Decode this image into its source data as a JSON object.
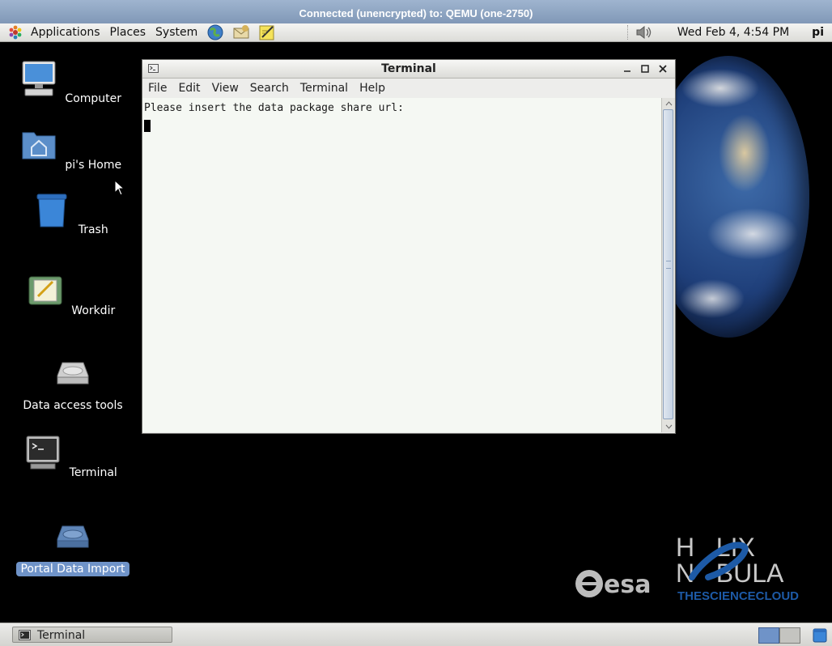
{
  "vnc": {
    "title": "Connected (unencrypted) to: QEMU (one-2750)"
  },
  "top_panel": {
    "menus": [
      "Applications",
      "Places",
      "System"
    ],
    "launchers": [
      "web-browser-icon",
      "mail-client-icon",
      "text-editor-icon"
    ],
    "volume_icon": "speaker-icon",
    "clock": "Wed Feb  4,  4:54 PM",
    "user": "pi"
  },
  "desktop_icons": [
    {
      "label": "Computer",
      "icon": "computer-icon",
      "selected": false
    },
    {
      "label": "pi's Home",
      "icon": "home-folder-icon",
      "selected": false
    },
    {
      "label": "Trash",
      "icon": "trash-icon",
      "selected": false
    },
    {
      "label": "Workdir",
      "icon": "workdir-icon",
      "selected": false
    },
    {
      "label": "Data access tools",
      "icon": "drive-icon",
      "selected": false
    },
    {
      "label": "Terminal",
      "icon": "terminal-icon",
      "selected": false
    },
    {
      "label": "Portal Data Import",
      "icon": "drive-blue-icon",
      "selected": true
    }
  ],
  "terminal": {
    "title": "Terminal",
    "menus": [
      "File",
      "Edit",
      "View",
      "Search",
      "Terminal",
      "Help"
    ],
    "output": "Please insert the data package share url:"
  },
  "logos": {
    "esa": "esa",
    "helix_line1": "H   LIX",
    "helix_line2": "N   BULA",
    "helix_tagline": "THESCIENCECLOUD"
  },
  "bottom_panel": {
    "task": "Terminal",
    "workspaces": 2,
    "active_workspace": 1
  },
  "colors": {
    "selection": "#6f93c8",
    "helix_blue": "#1d5aa6"
  }
}
